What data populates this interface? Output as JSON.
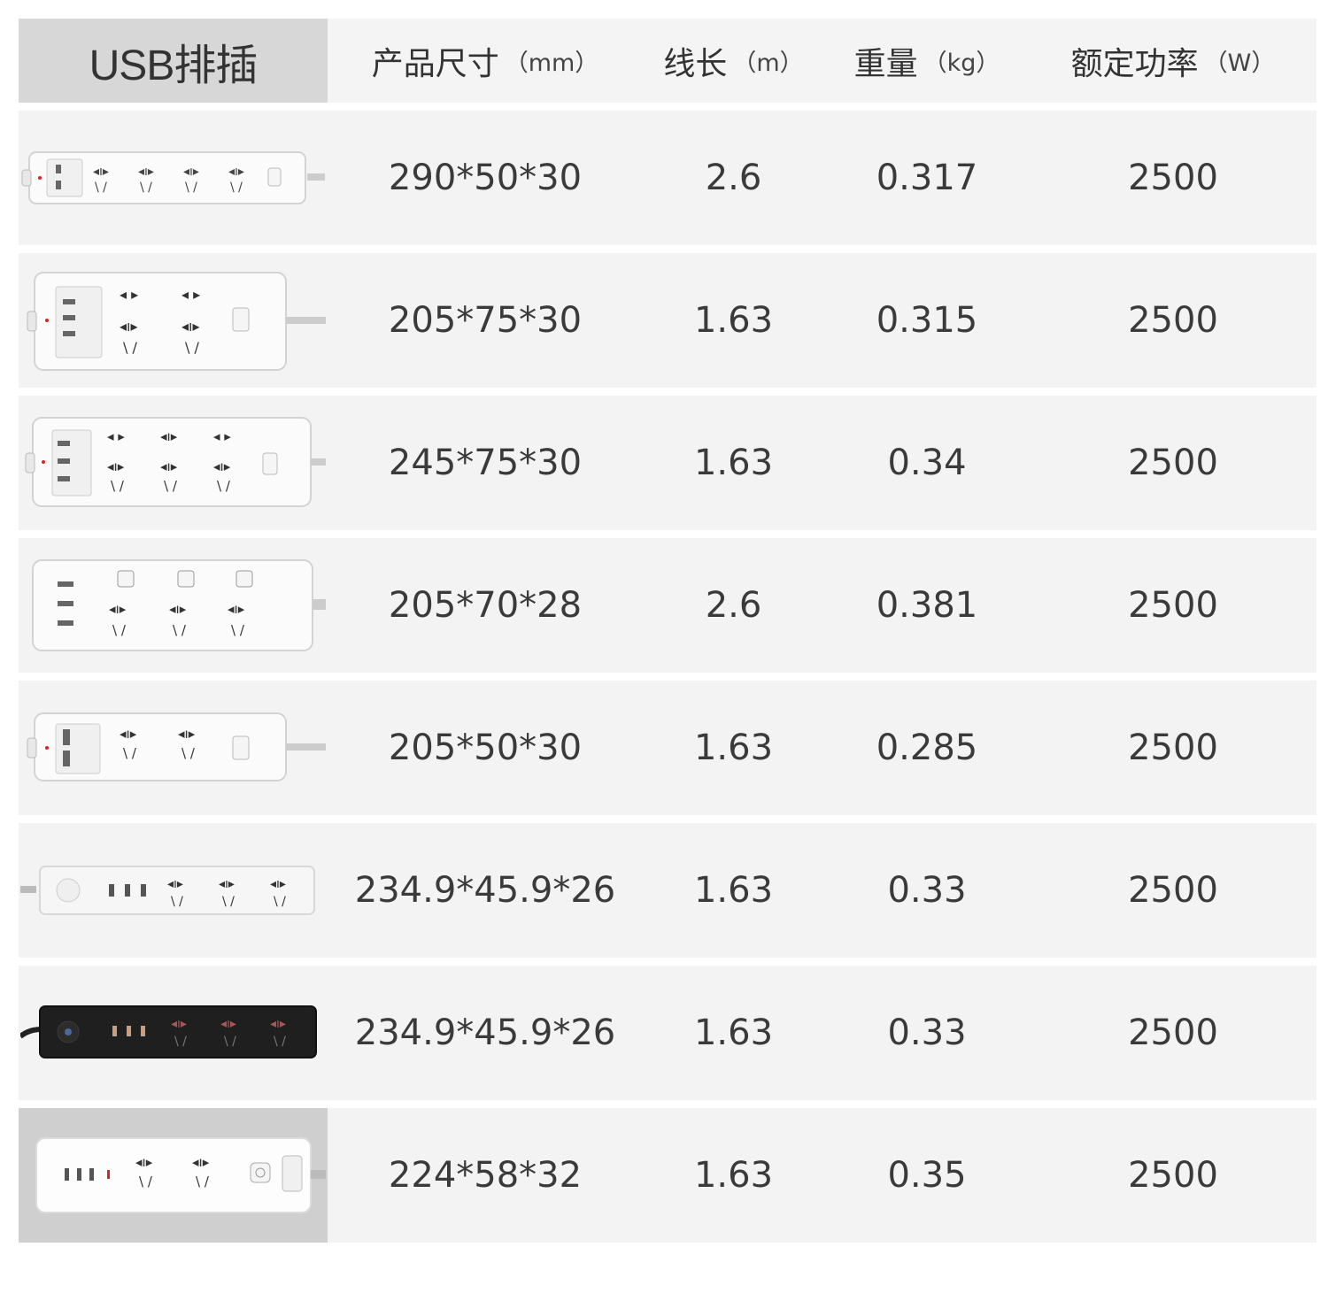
{
  "header": {
    "category": "USB排插",
    "columns": [
      {
        "label": "产品尺寸",
        "unit": "（mm）"
      },
      {
        "label": "线长",
        "unit": "（m）"
      },
      {
        "label": "重量",
        "unit": "（kg）"
      },
      {
        "label": "额定功率",
        "unit": "（W）"
      }
    ]
  },
  "rows": [
    {
      "image": "power-strip-4-outlet-2usb-white",
      "size": "290*50*30",
      "length": "2.6",
      "weight": "0.317",
      "power": "2500"
    },
    {
      "image": "power-strip-4-outlet-3usb-white",
      "size": "205*75*30",
      "length": "1.63",
      "weight": "0.315",
      "power": "2500"
    },
    {
      "image": "power-strip-6-outlet-3usb-white",
      "size": "245*75*30",
      "length": "1.63",
      "weight": "0.34",
      "power": "2500"
    },
    {
      "image": "power-strip-3-outlet-3switch-3usb-white",
      "size": "205*70*28",
      "length": "2.6",
      "weight": "0.381",
      "power": "2500"
    },
    {
      "image": "power-strip-2-outlet-2usb-white",
      "size": "205*50*30",
      "length": "1.63",
      "weight": "0.285",
      "power": "2500"
    },
    {
      "image": "power-strip-3-outlet-3usb-slim-white",
      "size": "234.9*45.9*26",
      "length": "1.63",
      "weight": "0.33",
      "power": "2500"
    },
    {
      "image": "power-strip-3-outlet-3usb-slim-black",
      "size": "234.9*45.9*26",
      "length": "1.63",
      "weight": "0.33",
      "power": "2500"
    },
    {
      "image": "power-strip-2-outlet-3usb-white",
      "size": "224*58*32",
      "length": "1.63",
      "weight": "0.35",
      "power": "2500"
    }
  ],
  "colors": {
    "header_bg": "#f4f4f4",
    "category_bg": "#d7d7d7",
    "row_bg": "#f3f3f3",
    "text": "#333333"
  }
}
